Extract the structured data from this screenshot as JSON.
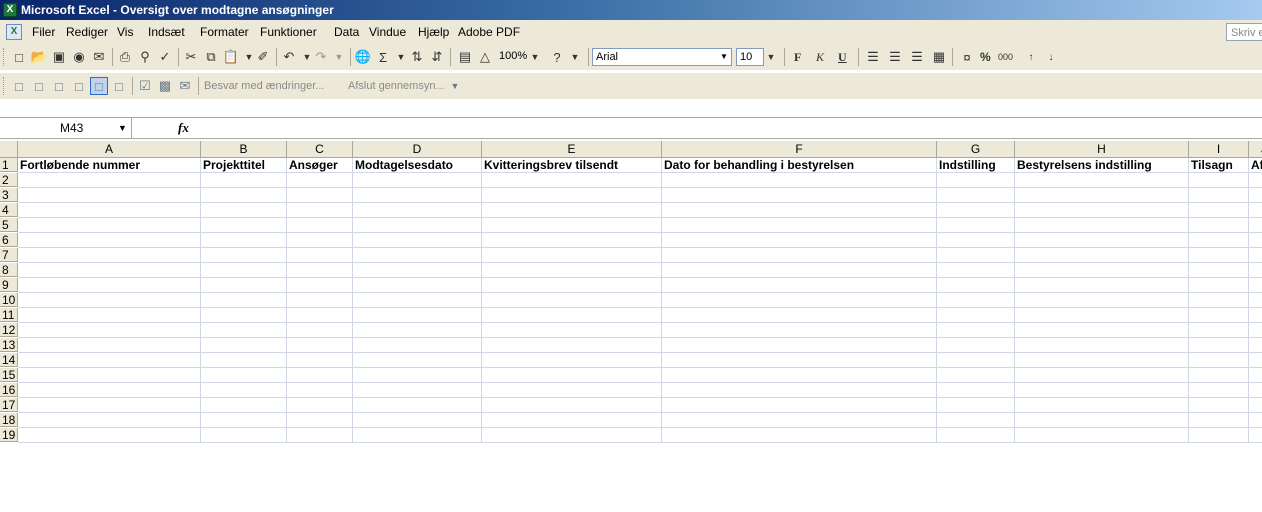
{
  "window": {
    "title": "Microsoft Excel - Oversigt over modtagne ansøgninger"
  },
  "menu": {
    "items": [
      "Filer",
      "Rediger",
      "Vis",
      "Indsæt",
      "Formater",
      "Funktioner",
      "Data",
      "Vindue",
      "Hjælp",
      "Adobe PDF"
    ],
    "help_placeholder": "Skriv e"
  },
  "standard_toolbar": {
    "zoom": "100%",
    "font": "Arial",
    "font_size": "10",
    "bold_label": "F",
    "italic_label": "K",
    "underline_label": "U",
    "percent_label": "%",
    "thousands_label": "000"
  },
  "review_toolbar": {
    "reply_label": "Besvar med ændringer...",
    "end_review_label": "Afslut gennemsyn..."
  },
  "formula_bar": {
    "name_box": "M43",
    "fx_label": "fx",
    "formula": ""
  },
  "sheet": {
    "columns": [
      "A",
      "B",
      "C",
      "D",
      "E",
      "F",
      "G",
      "H",
      "I",
      "J"
    ],
    "header_row": [
      "Fortløbende nummer",
      "Projekttitel",
      "Ansøger",
      "Modtagelsesdato",
      "Kvitteringsbrev tilsendt",
      "Dato for behandling i bestyrelsen",
      "Indstilling",
      "Bestyrelsens indstilling",
      "Tilsagn",
      "Afslag"
    ],
    "row_numbers": [
      "1",
      "2",
      "3",
      "4",
      "5",
      "6",
      "7",
      "8",
      "9",
      "10",
      "11",
      "12",
      "13",
      "14",
      "15",
      "16",
      "17",
      "18",
      "19"
    ]
  }
}
